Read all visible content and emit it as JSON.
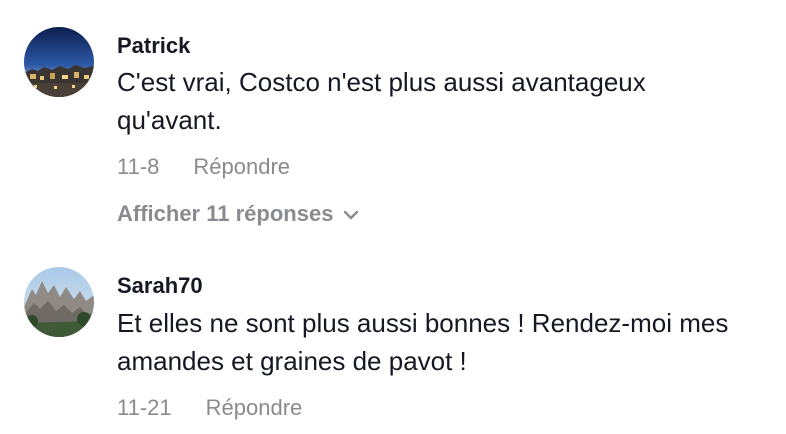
{
  "comments": [
    {
      "username": "Patrick",
      "text": "C'est vrai, Costco n'est plus aussi avantageux qu'avant.",
      "date": "11-8",
      "reply_label": "Répondre",
      "view_replies_label": "Afficher 11 réponses",
      "avatar_icon": "night-city-avatar"
    },
    {
      "username": "Sarah70",
      "text": "Et elles ne sont plus aussi bonnes ! Rendez-moi mes amandes et graines de pavot !",
      "date": "11-21",
      "reply_label": "Répondre",
      "avatar_icon": "mountain-avatar"
    }
  ],
  "colors": {
    "primary_text": "#161823",
    "secondary_text": "#8a8b91",
    "background": "#ffffff"
  }
}
